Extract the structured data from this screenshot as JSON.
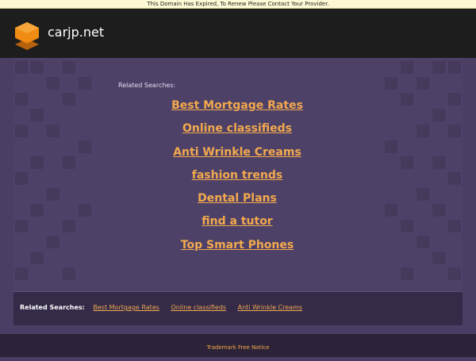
{
  "notice": {
    "text": "This Domain Has Expired, To Renew Please Contact Your Provider."
  },
  "header": {
    "site_name": "carjp.net"
  },
  "main": {
    "related_label": "Related Searches:",
    "links": [
      "Best Mortgage Rates",
      "Online classifieds",
      "Anti Wrinkle Creams",
      "fashion trends",
      "Dental Plans",
      "find a tutor",
      "Top Smart Phones"
    ]
  },
  "footer": {
    "related_label": "Related Searches:",
    "links": [
      "Best Mortgage Rates",
      "Online classifieds",
      "Anti Wrinkle Creams"
    ],
    "trademark": "Trademark Free Notice"
  },
  "colors": {
    "link": "#f2a94d",
    "header_bg": "#1d1d1d",
    "page_bg": "#4a3d63",
    "notice_bg": "#fdf9d4"
  },
  "icons": {
    "logo": "stacked-layers-icon"
  }
}
